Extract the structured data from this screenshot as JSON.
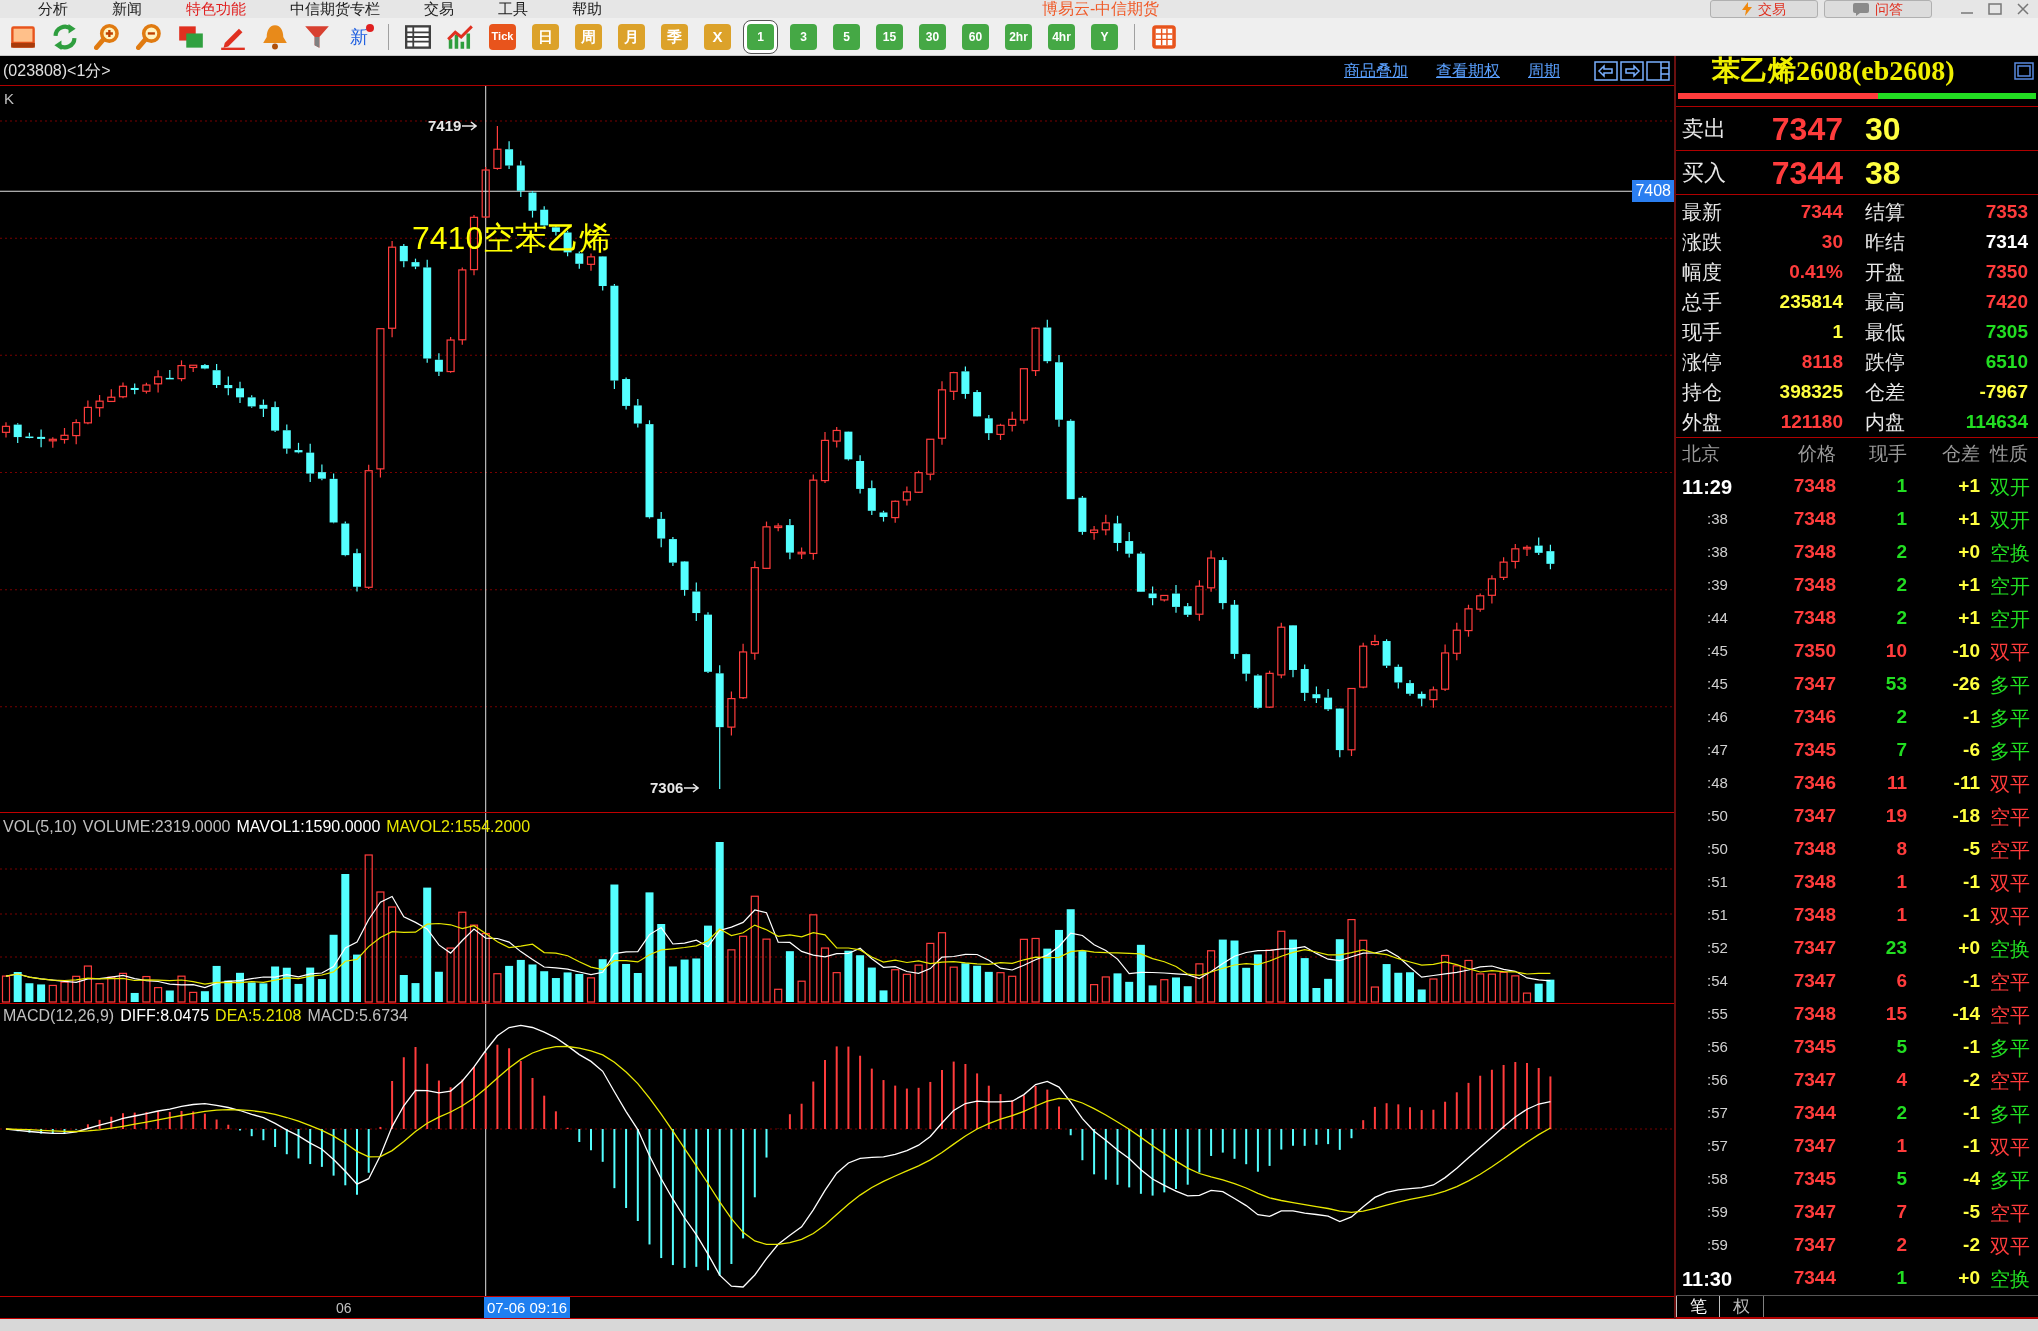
{
  "window": {
    "title": "博易云-中信期货"
  },
  "menu": [
    {
      "label": "分析",
      "highlighted": false
    },
    {
      "label": "新闻",
      "highlighted": false
    },
    {
      "label": "特色功能",
      "highlighted": true
    },
    {
      "label": "中信期货专栏",
      "highlighted": false
    },
    {
      "label": "交易",
      "highlighted": false
    },
    {
      "label": "工具",
      "highlighted": false
    },
    {
      "label": "帮助",
      "highlighted": false
    }
  ],
  "top_buttons": [
    {
      "label": "交易",
      "kind": "trade"
    },
    {
      "label": "问答",
      "kind": "qa"
    }
  ],
  "toolbar": {
    "news_label": "新",
    "periods": [
      {
        "label": "Tick",
        "kind": "tick",
        "selected": false
      },
      {
        "label": "日",
        "kind": "gold",
        "selected": false
      },
      {
        "label": "周",
        "kind": "gold",
        "selected": false
      },
      {
        "label": "月",
        "kind": "gold",
        "selected": false
      },
      {
        "label": "季",
        "kind": "gold",
        "selected": false
      },
      {
        "label": "X",
        "kind": "gold",
        "selected": false
      },
      {
        "label": "1",
        "kind": "green",
        "selected": true
      },
      {
        "label": "3",
        "kind": "green",
        "selected": false
      },
      {
        "label": "5",
        "kind": "green",
        "selected": false
      },
      {
        "label": "15",
        "kind": "green",
        "selected": false
      },
      {
        "label": "30",
        "kind": "green",
        "selected": false
      },
      {
        "label": "60",
        "kind": "green",
        "selected": false
      },
      {
        "label": "2hr",
        "kind": "green",
        "selected": false
      },
      {
        "label": "4hr",
        "kind": "green",
        "selected": false
      },
      {
        "label": "Y",
        "kind": "green",
        "selected": false
      }
    ]
  },
  "chart": {
    "symbol_label": "(023808)<1分>",
    "links": [
      "商品叠加",
      "查看期权",
      "周期"
    ],
    "k_label": "K",
    "high_marker": "7419",
    "low_marker": "7306",
    "crosshair_price": "7408",
    "annotation": "7410空苯乙烯",
    "axis_label": "06",
    "crosshair_time": "07-06 09:16"
  },
  "volume_legend": [
    {
      "text": "VOL(5,10)",
      "color": "#c0c0c0"
    },
    {
      "text": "VOLUME:2319.0000",
      "color": "#c0c0c0"
    },
    {
      "text": "MAVOL1:1590.0000",
      "color": "#ffffff"
    },
    {
      "text": "MAVOL2:1554.2000",
      "color": "#e8e800"
    }
  ],
  "macd_legend": [
    {
      "text": "MACD(12,26,9)",
      "color": "#c0c0c0"
    },
    {
      "text": "DIFF:8.0475",
      "color": "#ffffff"
    },
    {
      "text": "DEA:5.2108",
      "color": "#e8e800"
    },
    {
      "text": "MACD:5.6734",
      "color": "#c0c0c0"
    }
  ],
  "quote": {
    "title": "苯乙烯2608(eb2608)",
    "ratio_bar": {
      "level": 0.56
    },
    "sell": {
      "label": "卖出",
      "price": "7347",
      "volume": "30"
    },
    "buy": {
      "label": "买入",
      "price": "7344",
      "volume": "38"
    },
    "stats": [
      {
        "label": "最新",
        "value": "7344",
        "color": "#ff3c3c"
      },
      {
        "label": "结算",
        "value": "7353",
        "color": "#ff3c3c"
      },
      {
        "label": "涨跌",
        "value": "30",
        "color": "#ff3c3c"
      },
      {
        "label": "昨结",
        "value": "7314",
        "color": "#ffffff"
      },
      {
        "label": "幅度",
        "value": "0.41%",
        "color": "#ff3c3c"
      },
      {
        "label": "开盘",
        "value": "7350",
        "color": "#ff3c3c"
      },
      {
        "label": "总手",
        "value": "235814",
        "color": "#ffff40"
      },
      {
        "label": "最高",
        "value": "7420",
        "color": "#ff3c3c"
      },
      {
        "label": "现手",
        "value": "1",
        "color": "#ffff40"
      },
      {
        "label": "最低",
        "value": "7305",
        "color": "#22dd22"
      },
      {
        "label": "涨停",
        "value": "8118",
        "color": "#ff3c3c"
      },
      {
        "label": "跌停",
        "value": "6510",
        "color": "#22dd22"
      },
      {
        "label": "持仓",
        "value": "398325",
        "color": "#ffff40"
      },
      {
        "label": "仓差",
        "value": "-7967",
        "color": "#ffff40"
      },
      {
        "label": "外盘",
        "value": "121180",
        "color": "#ff3c3c"
      },
      {
        "label": "内盘",
        "value": "114634",
        "color": "#22dd22"
      }
    ]
  },
  "trades": {
    "columns": [
      "北京",
      "价格",
      "现手",
      "仓差",
      "性质"
    ],
    "rows": [
      {
        "time": "11:29",
        "kind": "full",
        "price": "7348",
        "volume": "1",
        "oi_change": "+1",
        "nature": "双开",
        "color": "#22dd22"
      },
      {
        "time": ":38",
        "kind": "short",
        "price": "7348",
        "volume": "1",
        "oi_change": "+1",
        "nature": "双开",
        "color": "#22dd22"
      },
      {
        "time": ":38",
        "kind": "short",
        "price": "7348",
        "volume": "2",
        "oi_change": "+0",
        "nature": "空换",
        "color": "#22dd22"
      },
      {
        "time": ":39",
        "kind": "short",
        "price": "7348",
        "volume": "2",
        "oi_change": "+1",
        "nature": "空开",
        "color": "#22dd22"
      },
      {
        "time": ":44",
        "kind": "short",
        "price": "7348",
        "volume": "2",
        "oi_change": "+1",
        "nature": "空开",
        "color": "#22dd22"
      },
      {
        "time": ":45",
        "kind": "short",
        "price": "7350",
        "volume": "10",
        "oi_change": "-10",
        "nature": "双平",
        "color": "#ff3c3c"
      },
      {
        "time": ":45",
        "kind": "short",
        "price": "7347",
        "volume": "53",
        "oi_change": "-26",
        "nature": "多平",
        "color": "#22dd22"
      },
      {
        "time": ":46",
        "kind": "short",
        "price": "7346",
        "volume": "2",
        "oi_change": "-1",
        "nature": "多平",
        "color": "#22dd22"
      },
      {
        "time": ":47",
        "kind": "short",
        "price": "7345",
        "volume": "7",
        "oi_change": "-6",
        "nature": "多平",
        "color": "#22dd22"
      },
      {
        "time": ":48",
        "kind": "short",
        "price": "7346",
        "volume": "11",
        "oi_change": "-11",
        "nature": "双平",
        "color": "#ff3c3c"
      },
      {
        "time": ":50",
        "kind": "short",
        "price": "7347",
        "volume": "19",
        "oi_change": "-18",
        "nature": "空平",
        "color": "#ff3c3c"
      },
      {
        "time": ":50",
        "kind": "short",
        "price": "7348",
        "volume": "8",
        "oi_change": "-5",
        "nature": "空平",
        "color": "#ff3c3c"
      },
      {
        "time": ":51",
        "kind": "short",
        "price": "7348",
        "volume": "1",
        "oi_change": "-1",
        "nature": "双平",
        "color": "#ff3c3c"
      },
      {
        "time": ":51",
        "kind": "short",
        "price": "7348",
        "volume": "1",
        "oi_change": "-1",
        "nature": "双平",
        "color": "#ff3c3c"
      },
      {
        "time": ":52",
        "kind": "short",
        "price": "7347",
        "volume": "23",
        "oi_change": "+0",
        "nature": "空换",
        "color": "#22dd22"
      },
      {
        "time": ":54",
        "kind": "short",
        "price": "7347",
        "volume": "6",
        "oi_change": "-1",
        "nature": "空平",
        "color": "#ff3c3c"
      },
      {
        "time": ":55",
        "kind": "short",
        "price": "7348",
        "volume": "15",
        "oi_change": "-14",
        "nature": "空平",
        "color": "#ff3c3c"
      },
      {
        "time": ":56",
        "kind": "short",
        "price": "7345",
        "volume": "5",
        "oi_change": "-1",
        "nature": "多平",
        "color": "#22dd22"
      },
      {
        "time": ":56",
        "kind": "short",
        "price": "7347",
        "volume": "4",
        "oi_change": "-2",
        "nature": "空平",
        "color": "#ff3c3c"
      },
      {
        "time": ":57",
        "kind": "short",
        "price": "7344",
        "volume": "2",
        "oi_change": "-1",
        "nature": "多平",
        "color": "#22dd22"
      },
      {
        "time": ":57",
        "kind": "short",
        "price": "7347",
        "volume": "1",
        "oi_change": "-1",
        "nature": "双平",
        "color": "#ff3c3c"
      },
      {
        "time": ":58",
        "kind": "short",
        "price": "7345",
        "volume": "5",
        "oi_change": "-4",
        "nature": "多平",
        "color": "#22dd22"
      },
      {
        "time": ":59",
        "kind": "short",
        "price": "7347",
        "volume": "7",
        "oi_change": "-5",
        "nature": "空平",
        "color": "#ff3c3c"
      },
      {
        "time": ":59",
        "kind": "short",
        "price": "7347",
        "volume": "2",
        "oi_change": "-2",
        "nature": "双平",
        "color": "#ff3c3c"
      },
      {
        "time": "11:30",
        "kind": "full",
        "price": "7344",
        "volume": "1",
        "oi_change": "+0",
        "nature": "空换",
        "color": "#22dd22"
      }
    ]
  },
  "bottom_tabs": [
    {
      "label": "笔",
      "selected": true
    },
    {
      "label": "权",
      "selected": false
    }
  ]
}
